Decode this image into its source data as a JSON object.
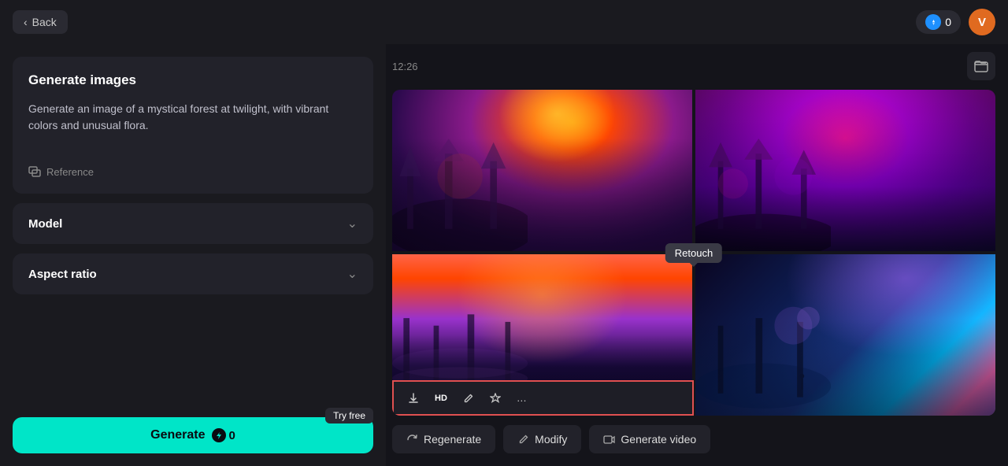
{
  "header": {
    "back_label": "Back",
    "credits_count": "0",
    "avatar_initial": "V"
  },
  "left_panel": {
    "title": "Generate images",
    "prompt": {
      "text": "Generate an image of a mystical forest at twilight, with vibrant colors and unusual flora.",
      "reference_label": "Reference"
    },
    "model": {
      "label": "Model"
    },
    "aspect_ratio": {
      "label": "Aspect ratio"
    },
    "generate_btn": {
      "label": "Generate",
      "credits": "0",
      "try_free_label": "Try free"
    }
  },
  "right_panel": {
    "timestamp": "12:26",
    "retouch_label": "Retouch",
    "toolbar": {
      "download_label": "↓",
      "hd_label": "HD",
      "edit_label": "✏",
      "magic_label": "✦",
      "more_label": "…"
    },
    "actions": {
      "regenerate_label": "Regenerate",
      "modify_label": "Modify",
      "generate_video_label": "Generate video"
    }
  }
}
